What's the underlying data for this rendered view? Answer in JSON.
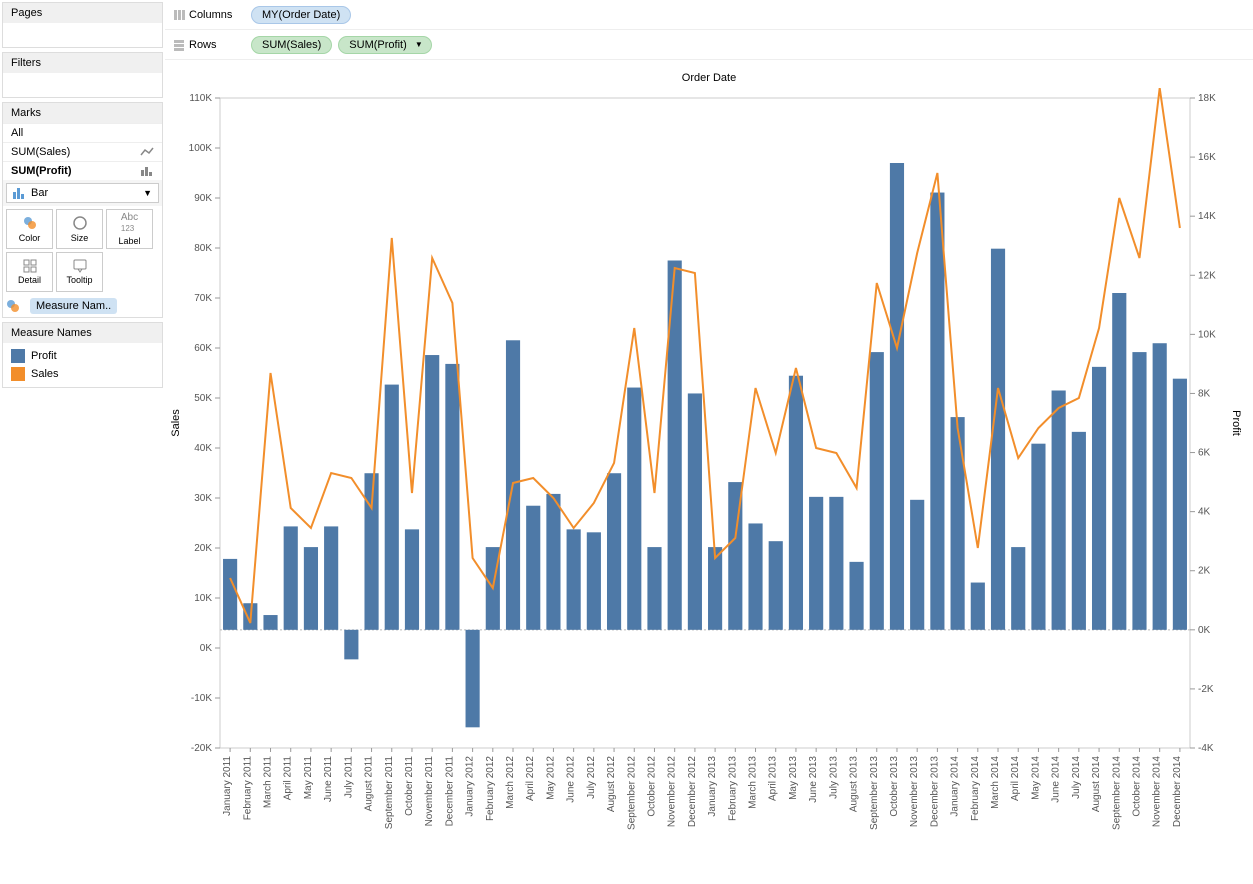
{
  "sidebar": {
    "pages_label": "Pages",
    "filters_label": "Filters",
    "marks_label": "Marks",
    "marks_all": "All",
    "marks_sales": "SUM(Sales)",
    "marks_profit": "SUM(Profit)",
    "mark_type": "Bar",
    "mark_buttons": {
      "color": "Color",
      "size": "Size",
      "label": "Label",
      "detail": "Detail",
      "tooltip": "Tooltip"
    },
    "measure_pill": "Measure Nam..",
    "legend_title": "Measure Names",
    "legend_profit": "Profit",
    "legend_sales": "Sales"
  },
  "shelves": {
    "columns_label": "Columns",
    "rows_label": "Rows",
    "columns_pill": "MY(Order Date)",
    "rows_pill_1": "SUM(Sales)",
    "rows_pill_2": "SUM(Profit)"
  },
  "chart": {
    "title": "Order Date",
    "y_left_label": "Sales",
    "y_right_label": "Profit",
    "colors": {
      "profit": "#4e79a7",
      "sales": "#f28e2b"
    }
  },
  "chart_data": {
    "type": "combo",
    "title": "Order Date",
    "y_left_label": "Sales",
    "y_right_label": "Profit",
    "y_left_range": [
      -20000,
      110000
    ],
    "y_right_range": [
      -4000,
      18000
    ],
    "y_left_ticks": [
      -20000,
      -10000,
      0,
      10000,
      20000,
      30000,
      40000,
      50000,
      60000,
      70000,
      80000,
      90000,
      100000,
      110000
    ],
    "y_left_tick_labels": [
      "-20K",
      "-10K",
      "0K",
      "10K",
      "20K",
      "30K",
      "40K",
      "50K",
      "60K",
      "70K",
      "80K",
      "90K",
      "100K",
      "110K"
    ],
    "y_right_ticks": [
      -4000,
      -2000,
      0,
      2000,
      4000,
      6000,
      8000,
      10000,
      12000,
      14000,
      16000,
      18000
    ],
    "y_right_tick_labels": [
      "-4K",
      "-2K",
      "0K",
      "2K",
      "4K",
      "6K",
      "8K",
      "10K",
      "12K",
      "14K",
      "16K",
      "18K"
    ],
    "categories": [
      "January 2011",
      "February 2011",
      "March 2011",
      "April 2011",
      "May 2011",
      "June 2011",
      "July 2011",
      "August 2011",
      "September 2011",
      "October 2011",
      "November 2011",
      "December 2011",
      "January 2012",
      "February 2012",
      "March 2012",
      "April 2012",
      "May 2012",
      "June 2012",
      "July 2012",
      "August 2012",
      "September 2012",
      "October 2012",
      "November 2012",
      "December 2012",
      "January 2013",
      "February 2013",
      "March 2013",
      "April 2013",
      "May 2013",
      "June 2013",
      "July 2013",
      "August 2013",
      "September 2013",
      "October 2013",
      "November 2013",
      "December 2013",
      "January 2014",
      "February 2014",
      "March 2014",
      "April 2014",
      "May 2014",
      "June 2014",
      "July 2014",
      "August 2014",
      "September 2014",
      "October 2014",
      "November 2014",
      "December 2014"
    ],
    "series": [
      {
        "name": "Profit",
        "type": "bar",
        "axis": "right",
        "values": [
          2400,
          900,
          500,
          3500,
          2800,
          3500,
          -1000,
          5300,
          8300,
          3400,
          9300,
          9000,
          -3300,
          2800,
          9800,
          4200,
          4600,
          3400,
          3300,
          5300,
          8200,
          2800,
          12500,
          8000,
          2800,
          5000,
          3600,
          3000,
          8600,
          4500,
          4500,
          2300,
          9400,
          15800,
          4400,
          14800,
          7200,
          1600,
          12900,
          2800,
          6300,
          8100,
          6700,
          8900,
          11400,
          9400,
          9700,
          8500
        ],
        "color": "#4e79a7"
      },
      {
        "name": "Sales",
        "type": "line",
        "axis": "left",
        "values": [
          14000,
          5000,
          55000,
          28000,
          24000,
          35000,
          34000,
          28000,
          82000,
          31000,
          78000,
          69000,
          18000,
          12000,
          33000,
          34000,
          30000,
          24000,
          29000,
          37000,
          64000,
          31000,
          76000,
          75000,
          18000,
          22000,
          52000,
          39000,
          56000,
          40000,
          39000,
          32000,
          73000,
          60000,
          79000,
          95000,
          44000,
          20000,
          52000,
          38000,
          44000,
          48000,
          50000,
          64000,
          90000,
          78000,
          112000,
          84000
        ],
        "color": "#f28e2b"
      }
    ]
  }
}
